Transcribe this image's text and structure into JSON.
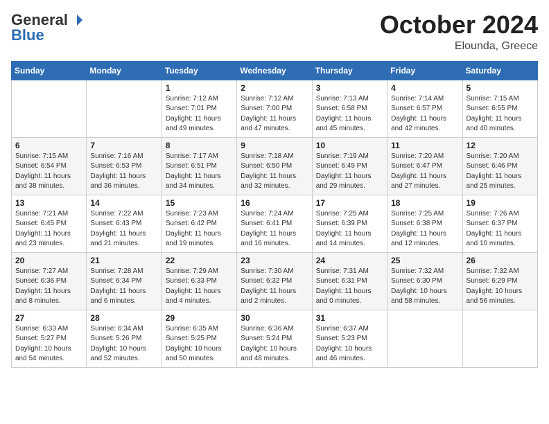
{
  "header": {
    "logo_general": "General",
    "logo_blue": "Blue",
    "title": "October 2024",
    "location": "Elounda, Greece"
  },
  "calendar": {
    "days_of_week": [
      "Sunday",
      "Monday",
      "Tuesday",
      "Wednesday",
      "Thursday",
      "Friday",
      "Saturday"
    ],
    "weeks": [
      [
        {
          "day": "",
          "info": ""
        },
        {
          "day": "",
          "info": ""
        },
        {
          "day": "1",
          "info": "Sunrise: 7:12 AM\nSunset: 7:01 PM\nDaylight: 11 hours and 49 minutes."
        },
        {
          "day": "2",
          "info": "Sunrise: 7:12 AM\nSunset: 7:00 PM\nDaylight: 11 hours and 47 minutes."
        },
        {
          "day": "3",
          "info": "Sunrise: 7:13 AM\nSunset: 6:58 PM\nDaylight: 11 hours and 45 minutes."
        },
        {
          "day": "4",
          "info": "Sunrise: 7:14 AM\nSunset: 6:57 PM\nDaylight: 11 hours and 42 minutes."
        },
        {
          "day": "5",
          "info": "Sunrise: 7:15 AM\nSunset: 6:55 PM\nDaylight: 11 hours and 40 minutes."
        }
      ],
      [
        {
          "day": "6",
          "info": "Sunrise: 7:15 AM\nSunset: 6:54 PM\nDaylight: 11 hours and 38 minutes."
        },
        {
          "day": "7",
          "info": "Sunrise: 7:16 AM\nSunset: 6:53 PM\nDaylight: 11 hours and 36 minutes."
        },
        {
          "day": "8",
          "info": "Sunrise: 7:17 AM\nSunset: 6:51 PM\nDaylight: 11 hours and 34 minutes."
        },
        {
          "day": "9",
          "info": "Sunrise: 7:18 AM\nSunset: 6:50 PM\nDaylight: 11 hours and 32 minutes."
        },
        {
          "day": "10",
          "info": "Sunrise: 7:19 AM\nSunset: 6:49 PM\nDaylight: 11 hours and 29 minutes."
        },
        {
          "day": "11",
          "info": "Sunrise: 7:20 AM\nSunset: 6:47 PM\nDaylight: 11 hours and 27 minutes."
        },
        {
          "day": "12",
          "info": "Sunrise: 7:20 AM\nSunset: 6:46 PM\nDaylight: 11 hours and 25 minutes."
        }
      ],
      [
        {
          "day": "13",
          "info": "Sunrise: 7:21 AM\nSunset: 6:45 PM\nDaylight: 11 hours and 23 minutes."
        },
        {
          "day": "14",
          "info": "Sunrise: 7:22 AM\nSunset: 6:43 PM\nDaylight: 11 hours and 21 minutes."
        },
        {
          "day": "15",
          "info": "Sunrise: 7:23 AM\nSunset: 6:42 PM\nDaylight: 11 hours and 19 minutes."
        },
        {
          "day": "16",
          "info": "Sunrise: 7:24 AM\nSunset: 6:41 PM\nDaylight: 11 hours and 16 minutes."
        },
        {
          "day": "17",
          "info": "Sunrise: 7:25 AM\nSunset: 6:39 PM\nDaylight: 11 hours and 14 minutes."
        },
        {
          "day": "18",
          "info": "Sunrise: 7:25 AM\nSunset: 6:38 PM\nDaylight: 11 hours and 12 minutes."
        },
        {
          "day": "19",
          "info": "Sunrise: 7:26 AM\nSunset: 6:37 PM\nDaylight: 11 hours and 10 minutes."
        }
      ],
      [
        {
          "day": "20",
          "info": "Sunrise: 7:27 AM\nSunset: 6:36 PM\nDaylight: 11 hours and 8 minutes."
        },
        {
          "day": "21",
          "info": "Sunrise: 7:28 AM\nSunset: 6:34 PM\nDaylight: 11 hours and 6 minutes."
        },
        {
          "day": "22",
          "info": "Sunrise: 7:29 AM\nSunset: 6:33 PM\nDaylight: 11 hours and 4 minutes."
        },
        {
          "day": "23",
          "info": "Sunrise: 7:30 AM\nSunset: 6:32 PM\nDaylight: 11 hours and 2 minutes."
        },
        {
          "day": "24",
          "info": "Sunrise: 7:31 AM\nSunset: 6:31 PM\nDaylight: 11 hours and 0 minutes."
        },
        {
          "day": "25",
          "info": "Sunrise: 7:32 AM\nSunset: 6:30 PM\nDaylight: 10 hours and 58 minutes."
        },
        {
          "day": "26",
          "info": "Sunrise: 7:32 AM\nSunset: 6:29 PM\nDaylight: 10 hours and 56 minutes."
        }
      ],
      [
        {
          "day": "27",
          "info": "Sunrise: 6:33 AM\nSunset: 5:27 PM\nDaylight: 10 hours and 54 minutes."
        },
        {
          "day": "28",
          "info": "Sunrise: 6:34 AM\nSunset: 5:26 PM\nDaylight: 10 hours and 52 minutes."
        },
        {
          "day": "29",
          "info": "Sunrise: 6:35 AM\nSunset: 5:25 PM\nDaylight: 10 hours and 50 minutes."
        },
        {
          "day": "30",
          "info": "Sunrise: 6:36 AM\nSunset: 5:24 PM\nDaylight: 10 hours and 48 minutes."
        },
        {
          "day": "31",
          "info": "Sunrise: 6:37 AM\nSunset: 5:23 PM\nDaylight: 10 hours and 46 minutes."
        },
        {
          "day": "",
          "info": ""
        },
        {
          "day": "",
          "info": ""
        }
      ]
    ]
  }
}
